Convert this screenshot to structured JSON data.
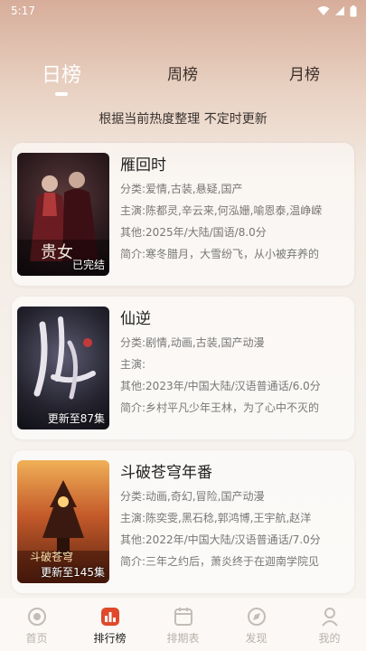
{
  "status": {
    "time": "5:17"
  },
  "tabs": [
    {
      "label": "日榜",
      "active": true
    },
    {
      "label": "周榜",
      "active": false
    },
    {
      "label": "月榜",
      "active": false
    }
  ],
  "subtitle": "根据当前热度整理 不定时更新",
  "labels": {
    "genre": "分类:",
    "cast": "主演:",
    "other": "其他:",
    "intro": "简介:"
  },
  "items": [
    {
      "title": "雁回时",
      "genre": "爱情,古装,悬疑,国产",
      "cast": "陈都灵,辛云来,何泓姗,喻恩泰,温峥嵘",
      "other": "2025年/大陆/国语/8.0分",
      "intro": "寒冬腊月，大雪纷飞，从小被弃养的",
      "badge": "已完结",
      "poster_text": "贵女"
    },
    {
      "title": "仙逆",
      "genre": "剧情,动画,古装,国产动漫",
      "cast": "",
      "other": "2023年/中国大陆/汉语普通话/6.0分",
      "intro": "乡村平凡少年王林，为了心中不灭的",
      "badge": "更新至87集",
      "poster_text": "仙逆"
    },
    {
      "title": "斗破苍穹年番",
      "genre": "动画,奇幻,冒险,国产动漫",
      "cast": "陈奕雯,黑石稔,郭鸿博,王宇航,赵洋",
      "other": "2022年/中国大陆/汉语普通话/7.0分",
      "intro": "三年之约后，萧炎终于在迦南学院见",
      "badge": "更新至145集",
      "poster_text": "斗破苍穹"
    }
  ],
  "nav": [
    {
      "label": "首页",
      "icon": "home-icon",
      "active": false
    },
    {
      "label": "排行榜",
      "icon": "ranking-icon",
      "active": true
    },
    {
      "label": "排期表",
      "icon": "schedule-icon",
      "active": false
    },
    {
      "label": "发现",
      "icon": "discover-icon",
      "active": false
    },
    {
      "label": "我的",
      "icon": "profile-icon",
      "active": false
    }
  ],
  "colors": {
    "accent": "#e0492a",
    "inactive": "#b9b2ad"
  }
}
